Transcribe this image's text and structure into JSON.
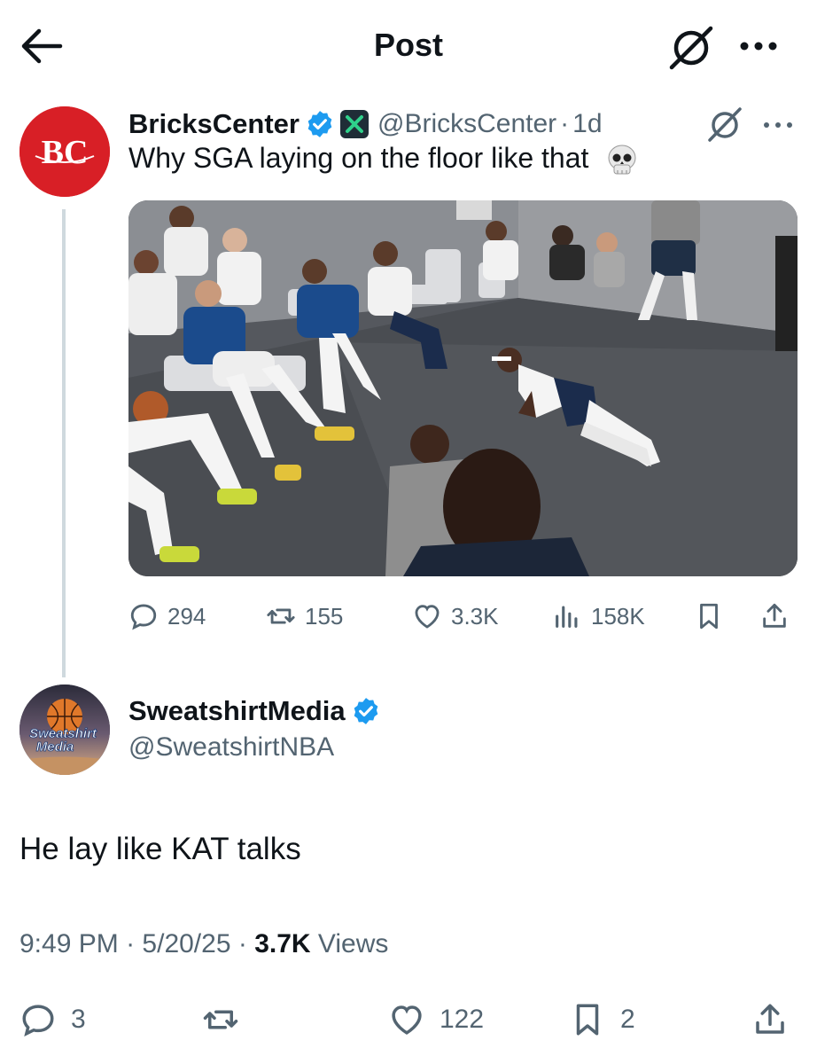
{
  "header": {
    "title": "Post"
  },
  "parent_tweet": {
    "author_name": "BricksCenter",
    "author_handle": "@BricksCenter",
    "separator": "·",
    "time": "1d",
    "avatar_initials": "BC",
    "text": "Why SGA laying on the floor like that",
    "actions": {
      "replies": "294",
      "reposts": "155",
      "likes": "3.3K",
      "views": "158K"
    }
  },
  "reply_tweet": {
    "author_name": "SweatshirtMedia",
    "author_handle": "@SweatshirtNBA",
    "avatar_text_line1": "Sweatshirt",
    "avatar_text_line2": "Media",
    "text": "He lay like KAT talks",
    "time": "9:49 PM",
    "date": "5/20/25",
    "separator": "·",
    "views_count": "3.7K",
    "views_label": "Views",
    "actions": {
      "replies": "3",
      "likes": "122",
      "bookmarks": "2"
    }
  },
  "colors": {
    "verified_blue": "#1d9bf0",
    "muted_text": "#536471",
    "primary_text": "#0f1419",
    "bc_red": "#d81f26"
  }
}
